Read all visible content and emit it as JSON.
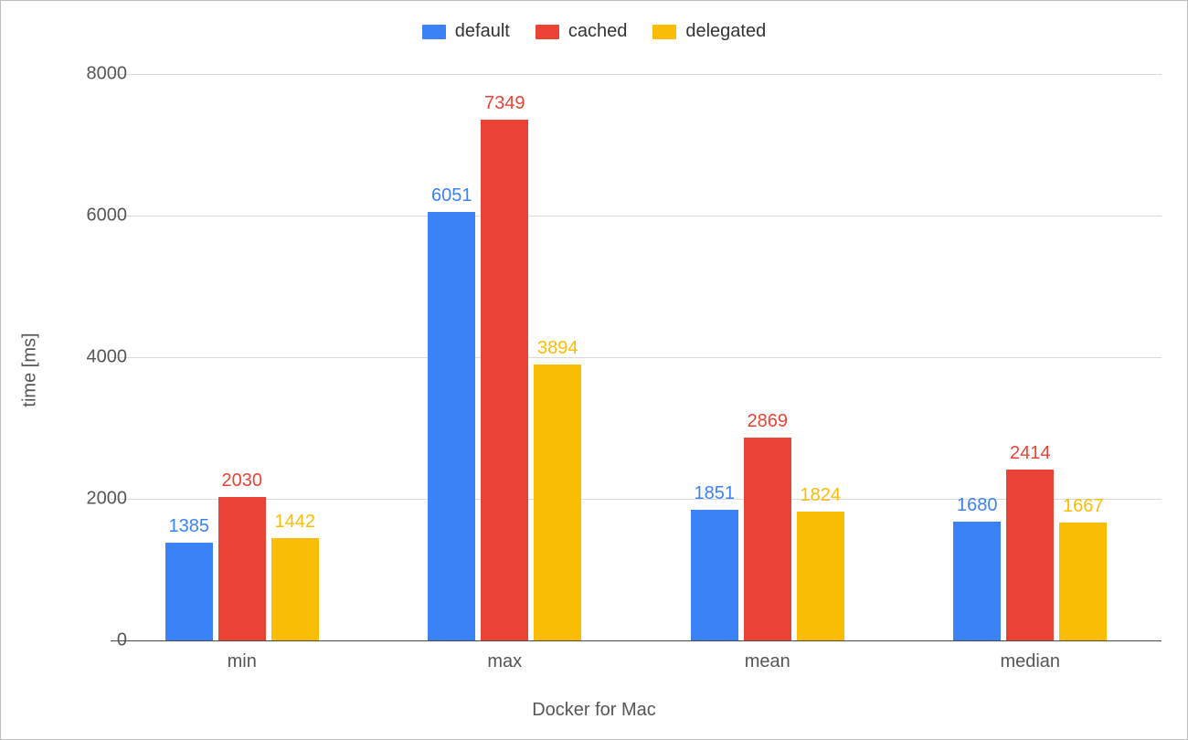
{
  "chart_data": {
    "type": "bar",
    "categories": [
      "min",
      "max",
      "mean",
      "median"
    ],
    "series": [
      {
        "name": "default",
        "color": "#3b82f6",
        "values": [
          1385,
          6051,
          1851,
          1680
        ]
      },
      {
        "name": "cached",
        "color": "#ea4335",
        "values": [
          2030,
          7349,
          2869,
          2414
        ]
      },
      {
        "name": "delegated",
        "color": "#fbbc05",
        "values": [
          1442,
          3894,
          1824,
          1667
        ]
      }
    ],
    "xlabel": "Docker for Mac",
    "ylabel": "time [ms]",
    "ylim": [
      0,
      8000
    ],
    "yticks": [
      0,
      2000,
      4000,
      6000,
      8000
    ],
    "title": ""
  }
}
